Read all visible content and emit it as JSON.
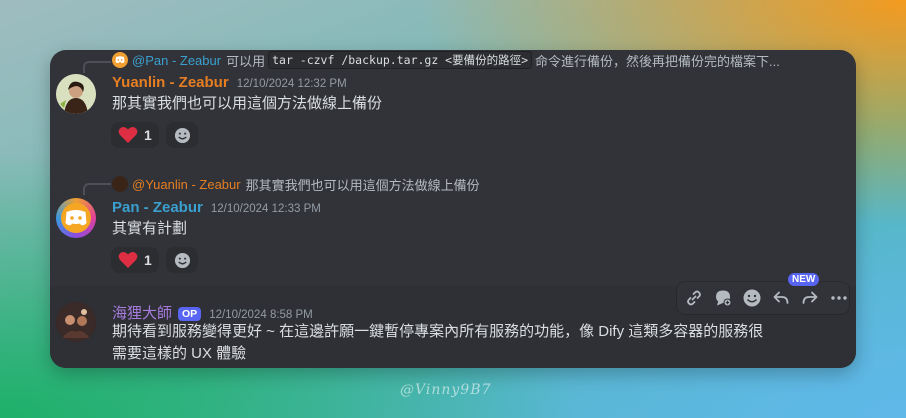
{
  "messages": [
    {
      "reply_to": {
        "name": "@Pan - Zeabur",
        "text_before": "可以用",
        "code": "tar -czvf /backup.tar.gz <要備份的路徑>",
        "text_after": "命令進行備份，然後再把備份完的檔案下..."
      },
      "author": "Yuanlin - Zeabur",
      "author_color": "#e67e22",
      "timestamp": "12/10/2024 12:32 PM",
      "text": "那其實我們也可以用這個方法做線上備份",
      "reactions": [
        {
          "emoji": "heart",
          "count": "1"
        }
      ]
    },
    {
      "reply_to": {
        "name": "@Yuanlin - Zeabur",
        "text": "那其實我們也可以用這個方法做線上備份"
      },
      "author": "Pan - Zeabur",
      "author_color": "#3ba0cf",
      "timestamp": "12/10/2024 12:33 PM",
      "text": "其實有計劃",
      "reactions": [
        {
          "emoji": "heart",
          "count": "1"
        }
      ]
    },
    {
      "author": "海狸大師",
      "author_color": "#a77bdc",
      "badge": "OP",
      "timestamp": "12/10/2024 8:58 PM",
      "text_line1": "期待看到服務變得更好 ~ 在這邊許願一鍵暫停專案內所有服務的功能，像 Dify 這類多容器的服務很",
      "text_line2": "需要這樣的 UX 體驗"
    }
  ],
  "toolbar": {
    "new_badge": "NEW",
    "icons": [
      "link-icon",
      "thread-icon",
      "add-reaction-icon",
      "reply-icon",
      "forward-icon",
      "more-icon"
    ]
  },
  "watermark": "@Vinny9B7",
  "colors": {
    "background": "#313338",
    "accent": "#5865f2",
    "heart": "#dd2e44"
  }
}
